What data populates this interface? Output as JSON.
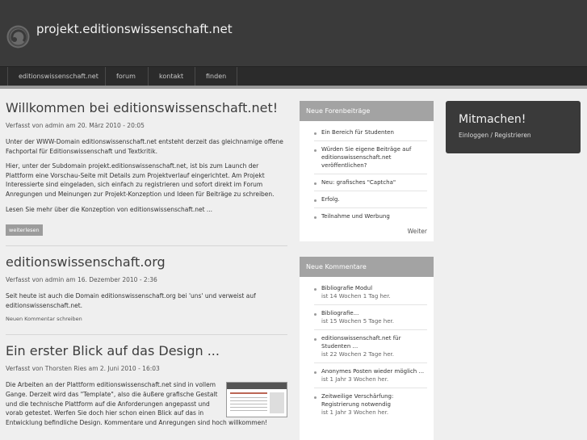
{
  "header": {
    "title": "projekt.editionswissenschaft.net"
  },
  "nav": {
    "items": [
      {
        "label": "editionswissenschaft.net"
      },
      {
        "label": "forum"
      },
      {
        "label": "kontakt"
      },
      {
        "label": "finden"
      }
    ]
  },
  "posts": [
    {
      "title": "Willkommen bei editionswissenschaft.net!",
      "meta": "Verfasst von admin am 20. März 2010 - 20:05",
      "paragraphs": [
        "Unter der WWW-Domain editionswissenschaft.net entsteht derzeit das gleichnamige offene Fachportal für Editionswissenschaft und Textkritik.",
        "Hier, unter der Subdomain projekt.editionswissenschaft.net, ist bis zum Launch der Plattform eine Vorschau-Seite mit Details zum Projektverlauf eingerichtet. Am Projekt Interessierte sind eingeladen, sich einfach zu registrieren und sofort direkt im Forum Anregungen und Meinungen zur Projekt-Konzeption und Ideen für Beiträge zu schreiben.",
        "Lesen Sie mehr über die Konzeption von editionswissenschaft.net ..."
      ],
      "readmore": "weiterlesen"
    },
    {
      "title": "editionswissenschaft.org",
      "meta": "Verfasst von admin am 16. Dezember 2010 - 2:36",
      "paragraphs": [
        "Seit heute ist auch die Domain editionswissenschaft.org bei 'uns' und verweist auf editionswissenschaft.net."
      ],
      "comment_link": "Neuen Kommentar schreiben"
    },
    {
      "title": "Ein erster Blick auf das Design ...",
      "meta": "Verfasst von Thorsten Ries am 2. Juni 2010 - 16:03",
      "paragraphs": [
        "Die Arbeiten an der Plattform editionswissenschaft.net sind in vollem Gange. Derzeit wird das \"Template\", also die äußere grafische Gestalt und die technische Plattform auf die Anforderungen angepasst und vorab getestet. Werfen Sie doch hier schon einen Blick auf das in Entwicklung befindliche Design. Kommentare und Anregungen sind hoch willkommen!"
      ]
    }
  ],
  "forum_box": {
    "header": "Neue Forenbeiträge",
    "items": [
      "Ein Bereich für Studenten",
      "Würden Sie eigene Beiträge auf editionswissenschaft.net veröffentlichen?",
      "Neu: grafisches \"Captcha\"",
      "Erfolg.",
      "Teilnahme und Werbung"
    ],
    "more": "Weiter"
  },
  "comments_box": {
    "header": "Neue Kommentare",
    "items": [
      {
        "title": "Bibliografie Modul",
        "age": "ist 14 Wochen 1 Tag her."
      },
      {
        "title": "Bibliografie...",
        "age": "ist 15 Wochen 5 Tage her."
      },
      {
        "title": "editionswissenschaft.net für Studenten ...",
        "age": "ist 22 Wochen 2 Tage her."
      },
      {
        "title": "Anonymes Posten wieder möglich ...",
        "age": "ist 1 Jahr 3 Wochen her."
      },
      {
        "title": "Zeitweilige Verschärfung: Registrierung notwendig",
        "age": "ist 1 Jahr 3 Wochen her."
      }
    ]
  },
  "join_box": {
    "title": "Mitmachen!",
    "links": "Einloggen / Registrieren"
  },
  "colors": {
    "header_bg": "#3a3a3a",
    "nav_bg": "#2b2b2b",
    "page_bg": "#efefef",
    "box_header_bg": "#a3a3a3"
  }
}
